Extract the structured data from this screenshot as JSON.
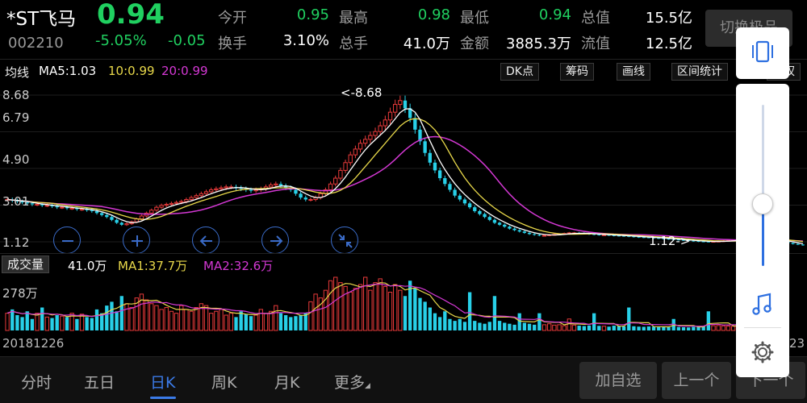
{
  "stock": {
    "name": "*ST飞马",
    "code": "002210",
    "price": "0.94",
    "change_pct": "-5.05%",
    "change": "-0.05"
  },
  "quote": [
    {
      "label": "今开",
      "value": "0.95",
      "color": "green"
    },
    {
      "label": "最高",
      "value": "0.98",
      "color": "green"
    },
    {
      "label": "最低",
      "value": "0.94",
      "color": "green"
    },
    {
      "label": "总值",
      "value": "15.5亿",
      "color": "white"
    },
    {
      "label": "换手",
      "value": "3.10%",
      "color": "white"
    },
    {
      "label": "总手",
      "value": "41.0万",
      "color": "white"
    },
    {
      "label": "金额",
      "value": "3885.3万",
      "color": "white"
    },
    {
      "label": "流值",
      "value": "12.5亿",
      "color": "white"
    }
  ],
  "switch_button": "切换极品",
  "ma_row": {
    "title": "均线",
    "ma5": "MA5:1.03",
    "ma10": "10:0.99",
    "ma20": "20:0.99"
  },
  "tools": [
    "DK点",
    "筹码",
    "画线",
    "区间统计",
    "复权"
  ],
  "price_axis": [
    "8.68",
    "6.79",
    "4.90",
    "3.01",
    "1.12"
  ],
  "annotations": {
    "high": "<-8.68",
    "low": "1.12->"
  },
  "volume": {
    "button": "成交量",
    "vol": "41.0万",
    "ma1": "MA1:37.7万",
    "ma2": "MA2:32.6万",
    "axis": "278万"
  },
  "dates": {
    "start": "20181226",
    "end": "23"
  },
  "tabs": [
    "分时",
    "五日",
    "日K",
    "周K",
    "月K",
    "更多"
  ],
  "active_tab": "日K",
  "actions": [
    "加自选",
    "上一个",
    "下一个"
  ],
  "colors": {
    "up": "#e83a3a",
    "down": "#28d0e8",
    "ma5": "#ffffff",
    "ma10": "#e8d84a",
    "ma20": "#d438d4",
    "accent": "#3b7be8"
  },
  "chart_data": {
    "type": "candlestick",
    "ylim": [
      1.12,
      8.68
    ],
    "y_ticks": [
      8.68,
      6.79,
      4.9,
      3.01,
      1.12
    ],
    "volume_max": 2780000,
    "max_label": 8.68,
    "min_label": 1.12,
    "close": [
      3.3,
      3.25,
      3.2,
      3.15,
      3.1,
      3.05,
      3.05,
      3.0,
      3.0,
      2.95,
      2.9,
      2.9,
      2.85,
      2.85,
      2.8,
      2.8,
      2.75,
      2.7,
      2.6,
      2.5,
      2.4,
      2.25,
      2.1,
      2.0,
      2.05,
      2.15,
      2.3,
      2.45,
      2.6,
      2.75,
      2.9,
      3.0,
      3.05,
      3.1,
      3.15,
      3.2,
      3.3,
      3.4,
      3.5,
      3.6,
      3.7,
      3.8,
      3.85,
      3.9,
      3.95,
      3.95,
      3.9,
      3.85,
      3.8,
      3.75,
      3.8,
      3.85,
      3.95,
      4.05,
      4.1,
      4.0,
      3.9,
      3.8,
      3.6,
      3.4,
      3.3,
      3.3,
      3.4,
      3.6,
      3.8,
      4.1,
      4.4,
      4.8,
      5.2,
      5.6,
      5.9,
      6.2,
      6.4,
      6.6,
      6.8,
      7.1,
      7.4,
      7.8,
      8.2,
      8.4,
      8.0,
      7.5,
      6.9,
      6.3,
      5.7,
      5.2,
      4.8,
      4.4,
      4.1,
      3.8,
      3.5,
      3.3,
      3.1,
      2.9,
      2.7,
      2.55,
      2.4,
      2.25,
      2.1,
      2.0,
      1.9,
      1.8,
      1.72,
      1.65,
      1.58,
      1.52,
      1.48,
      1.45,
      1.45,
      1.48,
      1.5,
      1.52,
      1.55,
      1.58,
      1.58,
      1.56,
      1.54,
      1.52,
      1.5,
      1.48,
      1.48,
      1.46,
      1.44,
      1.43,
      1.42,
      1.4,
      1.38,
      1.36,
      1.35,
      1.34,
      1.32,
      1.3,
      1.28,
      1.26,
      1.24,
      1.22,
      1.2,
      1.18,
      1.16,
      1.14,
      1.13,
      1.12,
      1.14,
      1.15,
      1.17,
      1.19,
      1.2,
      1.22,
      1.24,
      1.26,
      1.27,
      1.28,
      1.27,
      1.25,
      1.22,
      1.18,
      1.12,
      1.06,
      1.01,
      0.98,
      0.94
    ],
    "volume": [
      900000,
      1100000,
      800000,
      700000,
      1000000,
      600000,
      900000,
      1200000,
      700000,
      650000,
      800000,
      750000,
      700000,
      900000,
      600000,
      850000,
      700000,
      650000,
      1100000,
      900000,
      1300000,
      1500000,
      1000000,
      1800000,
      1400000,
      1200000,
      1700000,
      1900000,
      1600000,
      1400000,
      1300000,
      1100000,
      1200000,
      1000000,
      900000,
      1300000,
      1100000,
      1000000,
      1200000,
      1400000,
      1300000,
      900000,
      1000000,
      1100000,
      800000,
      900000,
      700000,
      1000000,
      850000,
      750000,
      800000,
      1100000,
      900000,
      1000000,
      1300000,
      900000,
      800000,
      700000,
      750000,
      800000,
      900000,
      1500000,
      1900000,
      1700000,
      2100000,
      2600000,
      2780000,
      2500000,
      2300000,
      2000000,
      2200000,
      2400000,
      2780000,
      2100000,
      2500000,
      2700000,
      2300000,
      2000000,
      2400000,
      2100000,
      1800000,
      2600000,
      2200000,
      1700000,
      1500000,
      1200000,
      900000,
      700000,
      1000000,
      600000,
      500000,
      600000,
      450000,
      2000000,
      500000,
      400000,
      350000,
      450000,
      1800000,
      500000,
      400000,
      350000,
      300000,
      900000,
      400000,
      350000,
      300000,
      900000,
      300000,
      350000,
      280000,
      300000,
      250000,
      600000,
      280000,
      250000,
      230000,
      260000,
      900000,
      240000,
      220000,
      200000,
      250000,
      230000,
      210000,
      1200000,
      220000,
      200000,
      190000,
      210000,
      200000,
      180000,
      190000,
      170000,
      600000,
      180000,
      170000,
      160000,
      190000,
      200000,
      220000,
      1000000,
      250000,
      260000,
      240000,
      230000,
      220000,
      210000,
      200000,
      230000,
      250000,
      300000,
      350000,
      400000,
      380000,
      410000
    ]
  }
}
